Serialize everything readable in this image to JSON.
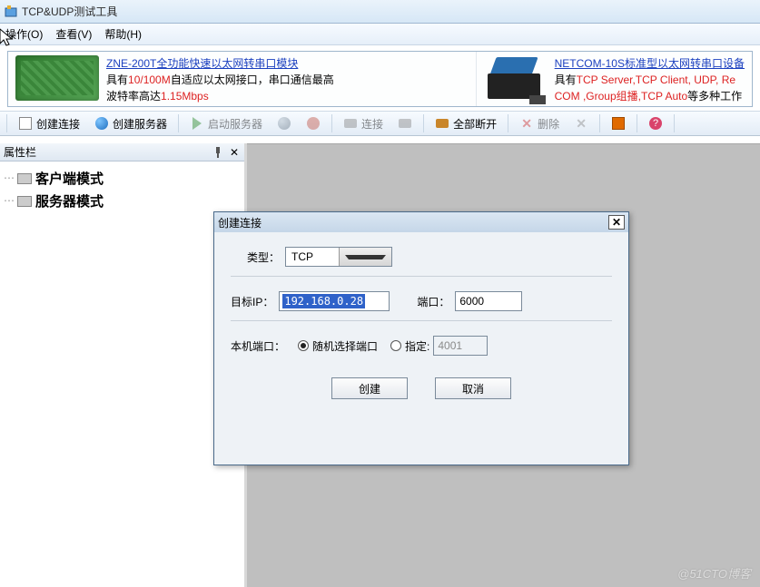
{
  "title": "TCP&UDP测试工具",
  "menu": {
    "operate": "操作(O)",
    "view": "查看(V)",
    "help": "帮助(H)"
  },
  "banner": {
    "left_link": "ZNE-200T全功能快速以太网转串口模块",
    "left_l1a": "具有",
    "left_l1b": "10/100M",
    "left_l1c": "自适应以太网接口，串口通信最高",
    "left_l2a": "波特率高达",
    "left_l2b": "1.15Mbps",
    "right_link": "NETCOM-10S标准型以太网转串口设备",
    "right_l1a": "具有",
    "right_l1b": "TCP Server,TCP Client, UDP, Re",
    "right_l2a": "COM ,Group组播,TCP Auto",
    "right_l2b": "等多种工作"
  },
  "toolbar": {
    "create_conn": "创建连接",
    "create_server": "创建服务器",
    "start_server": "启动服务器",
    "connect": "连接",
    "disconnect_all": "全部断开",
    "delete": "删除"
  },
  "sidebar": {
    "title": "属性栏",
    "node_client": "客户端模式",
    "node_server": "服务器模式"
  },
  "dialog": {
    "title": "创建连接",
    "type_label": "类型：",
    "type_value": "TCP",
    "ip_label": "目标IP：",
    "ip_value": "192.168.0.28",
    "port_label": "端口：",
    "port_value": "6000",
    "localport_label": "本机端口：",
    "radio_random": "随机选择端口",
    "radio_fixed": "指定:",
    "fixed_port": "4001",
    "ok": "创建",
    "cancel": "取消"
  },
  "watermark": "@51CTO博客"
}
